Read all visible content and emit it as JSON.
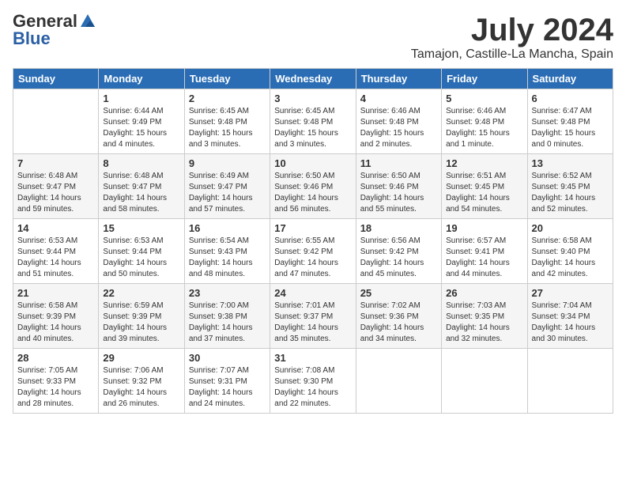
{
  "logo": {
    "general": "General",
    "blue": "Blue"
  },
  "title": "July 2024",
  "location": "Tamajon, Castille-La Mancha, Spain",
  "weekdays": [
    "Sunday",
    "Monday",
    "Tuesday",
    "Wednesday",
    "Thursday",
    "Friday",
    "Saturday"
  ],
  "weeks": [
    [
      {
        "day": "",
        "info": ""
      },
      {
        "day": "1",
        "info": "Sunrise: 6:44 AM\nSunset: 9:49 PM\nDaylight: 15 hours\nand 4 minutes."
      },
      {
        "day": "2",
        "info": "Sunrise: 6:45 AM\nSunset: 9:48 PM\nDaylight: 15 hours\nand 3 minutes."
      },
      {
        "day": "3",
        "info": "Sunrise: 6:45 AM\nSunset: 9:48 PM\nDaylight: 15 hours\nand 3 minutes."
      },
      {
        "day": "4",
        "info": "Sunrise: 6:46 AM\nSunset: 9:48 PM\nDaylight: 15 hours\nand 2 minutes."
      },
      {
        "day": "5",
        "info": "Sunrise: 6:46 AM\nSunset: 9:48 PM\nDaylight: 15 hours\nand 1 minute."
      },
      {
        "day": "6",
        "info": "Sunrise: 6:47 AM\nSunset: 9:48 PM\nDaylight: 15 hours\nand 0 minutes."
      }
    ],
    [
      {
        "day": "7",
        "info": "Sunrise: 6:48 AM\nSunset: 9:47 PM\nDaylight: 14 hours\nand 59 minutes."
      },
      {
        "day": "8",
        "info": "Sunrise: 6:48 AM\nSunset: 9:47 PM\nDaylight: 14 hours\nand 58 minutes."
      },
      {
        "day": "9",
        "info": "Sunrise: 6:49 AM\nSunset: 9:47 PM\nDaylight: 14 hours\nand 57 minutes."
      },
      {
        "day": "10",
        "info": "Sunrise: 6:50 AM\nSunset: 9:46 PM\nDaylight: 14 hours\nand 56 minutes."
      },
      {
        "day": "11",
        "info": "Sunrise: 6:50 AM\nSunset: 9:46 PM\nDaylight: 14 hours\nand 55 minutes."
      },
      {
        "day": "12",
        "info": "Sunrise: 6:51 AM\nSunset: 9:45 PM\nDaylight: 14 hours\nand 54 minutes."
      },
      {
        "day": "13",
        "info": "Sunrise: 6:52 AM\nSunset: 9:45 PM\nDaylight: 14 hours\nand 52 minutes."
      }
    ],
    [
      {
        "day": "14",
        "info": "Sunrise: 6:53 AM\nSunset: 9:44 PM\nDaylight: 14 hours\nand 51 minutes."
      },
      {
        "day": "15",
        "info": "Sunrise: 6:53 AM\nSunset: 9:44 PM\nDaylight: 14 hours\nand 50 minutes."
      },
      {
        "day": "16",
        "info": "Sunrise: 6:54 AM\nSunset: 9:43 PM\nDaylight: 14 hours\nand 48 minutes."
      },
      {
        "day": "17",
        "info": "Sunrise: 6:55 AM\nSunset: 9:42 PM\nDaylight: 14 hours\nand 47 minutes."
      },
      {
        "day": "18",
        "info": "Sunrise: 6:56 AM\nSunset: 9:42 PM\nDaylight: 14 hours\nand 45 minutes."
      },
      {
        "day": "19",
        "info": "Sunrise: 6:57 AM\nSunset: 9:41 PM\nDaylight: 14 hours\nand 44 minutes."
      },
      {
        "day": "20",
        "info": "Sunrise: 6:58 AM\nSunset: 9:40 PM\nDaylight: 14 hours\nand 42 minutes."
      }
    ],
    [
      {
        "day": "21",
        "info": "Sunrise: 6:58 AM\nSunset: 9:39 PM\nDaylight: 14 hours\nand 40 minutes."
      },
      {
        "day": "22",
        "info": "Sunrise: 6:59 AM\nSunset: 9:39 PM\nDaylight: 14 hours\nand 39 minutes."
      },
      {
        "day": "23",
        "info": "Sunrise: 7:00 AM\nSunset: 9:38 PM\nDaylight: 14 hours\nand 37 minutes."
      },
      {
        "day": "24",
        "info": "Sunrise: 7:01 AM\nSunset: 9:37 PM\nDaylight: 14 hours\nand 35 minutes."
      },
      {
        "day": "25",
        "info": "Sunrise: 7:02 AM\nSunset: 9:36 PM\nDaylight: 14 hours\nand 34 minutes."
      },
      {
        "day": "26",
        "info": "Sunrise: 7:03 AM\nSunset: 9:35 PM\nDaylight: 14 hours\nand 32 minutes."
      },
      {
        "day": "27",
        "info": "Sunrise: 7:04 AM\nSunset: 9:34 PM\nDaylight: 14 hours\nand 30 minutes."
      }
    ],
    [
      {
        "day": "28",
        "info": "Sunrise: 7:05 AM\nSunset: 9:33 PM\nDaylight: 14 hours\nand 28 minutes."
      },
      {
        "day": "29",
        "info": "Sunrise: 7:06 AM\nSunset: 9:32 PM\nDaylight: 14 hours\nand 26 minutes."
      },
      {
        "day": "30",
        "info": "Sunrise: 7:07 AM\nSunset: 9:31 PM\nDaylight: 14 hours\nand 24 minutes."
      },
      {
        "day": "31",
        "info": "Sunrise: 7:08 AM\nSunset: 9:30 PM\nDaylight: 14 hours\nand 22 minutes."
      },
      {
        "day": "",
        "info": ""
      },
      {
        "day": "",
        "info": ""
      },
      {
        "day": "",
        "info": ""
      }
    ]
  ]
}
